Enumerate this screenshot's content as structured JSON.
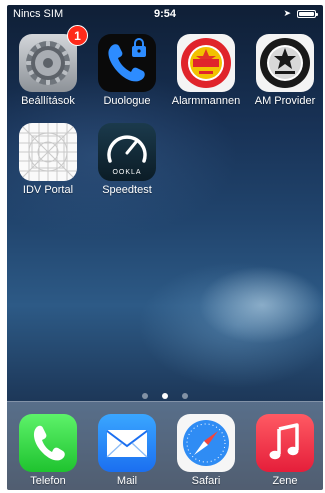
{
  "status_bar": {
    "carrier": "Nincs SIM",
    "time": "9:54"
  },
  "home": {
    "apps": [
      {
        "label": "Beállítások",
        "badge": "1",
        "icon": "gear-icon"
      },
      {
        "label": "Duologue",
        "icon": "phone-lock-icon"
      },
      {
        "label": "Alarmmannen",
        "icon": "alarmmannen-seal-icon",
        "seal_text": "ALARMMANNEN.COM"
      },
      {
        "label": "AM Provider",
        "icon": "alarmmannen-provider-seal-icon",
        "seal_text": "ALARMMANNEN.COM"
      },
      {
        "label": "IDV Portal",
        "icon": "grid-icon"
      },
      {
        "label": "Speedtest",
        "icon": "speedometer-icon",
        "brand": "OOKLA"
      }
    ],
    "page_dots": {
      "count": 3,
      "active": 1
    }
  },
  "dock": {
    "apps": [
      {
        "label": "Telefon",
        "icon": "phone-icon"
      },
      {
        "label": "Mail",
        "icon": "envelope-icon"
      },
      {
        "label": "Safari",
        "icon": "compass-icon"
      },
      {
        "label": "Zene",
        "icon": "music-note-icon"
      }
    ]
  },
  "colors": {
    "badge": "#ff2a1a",
    "phone_green": "#1fc32f",
    "mail_blue": "#1b6ff0",
    "music_red": "#e51e3a",
    "wallpaper_top": "#0f1f36"
  }
}
